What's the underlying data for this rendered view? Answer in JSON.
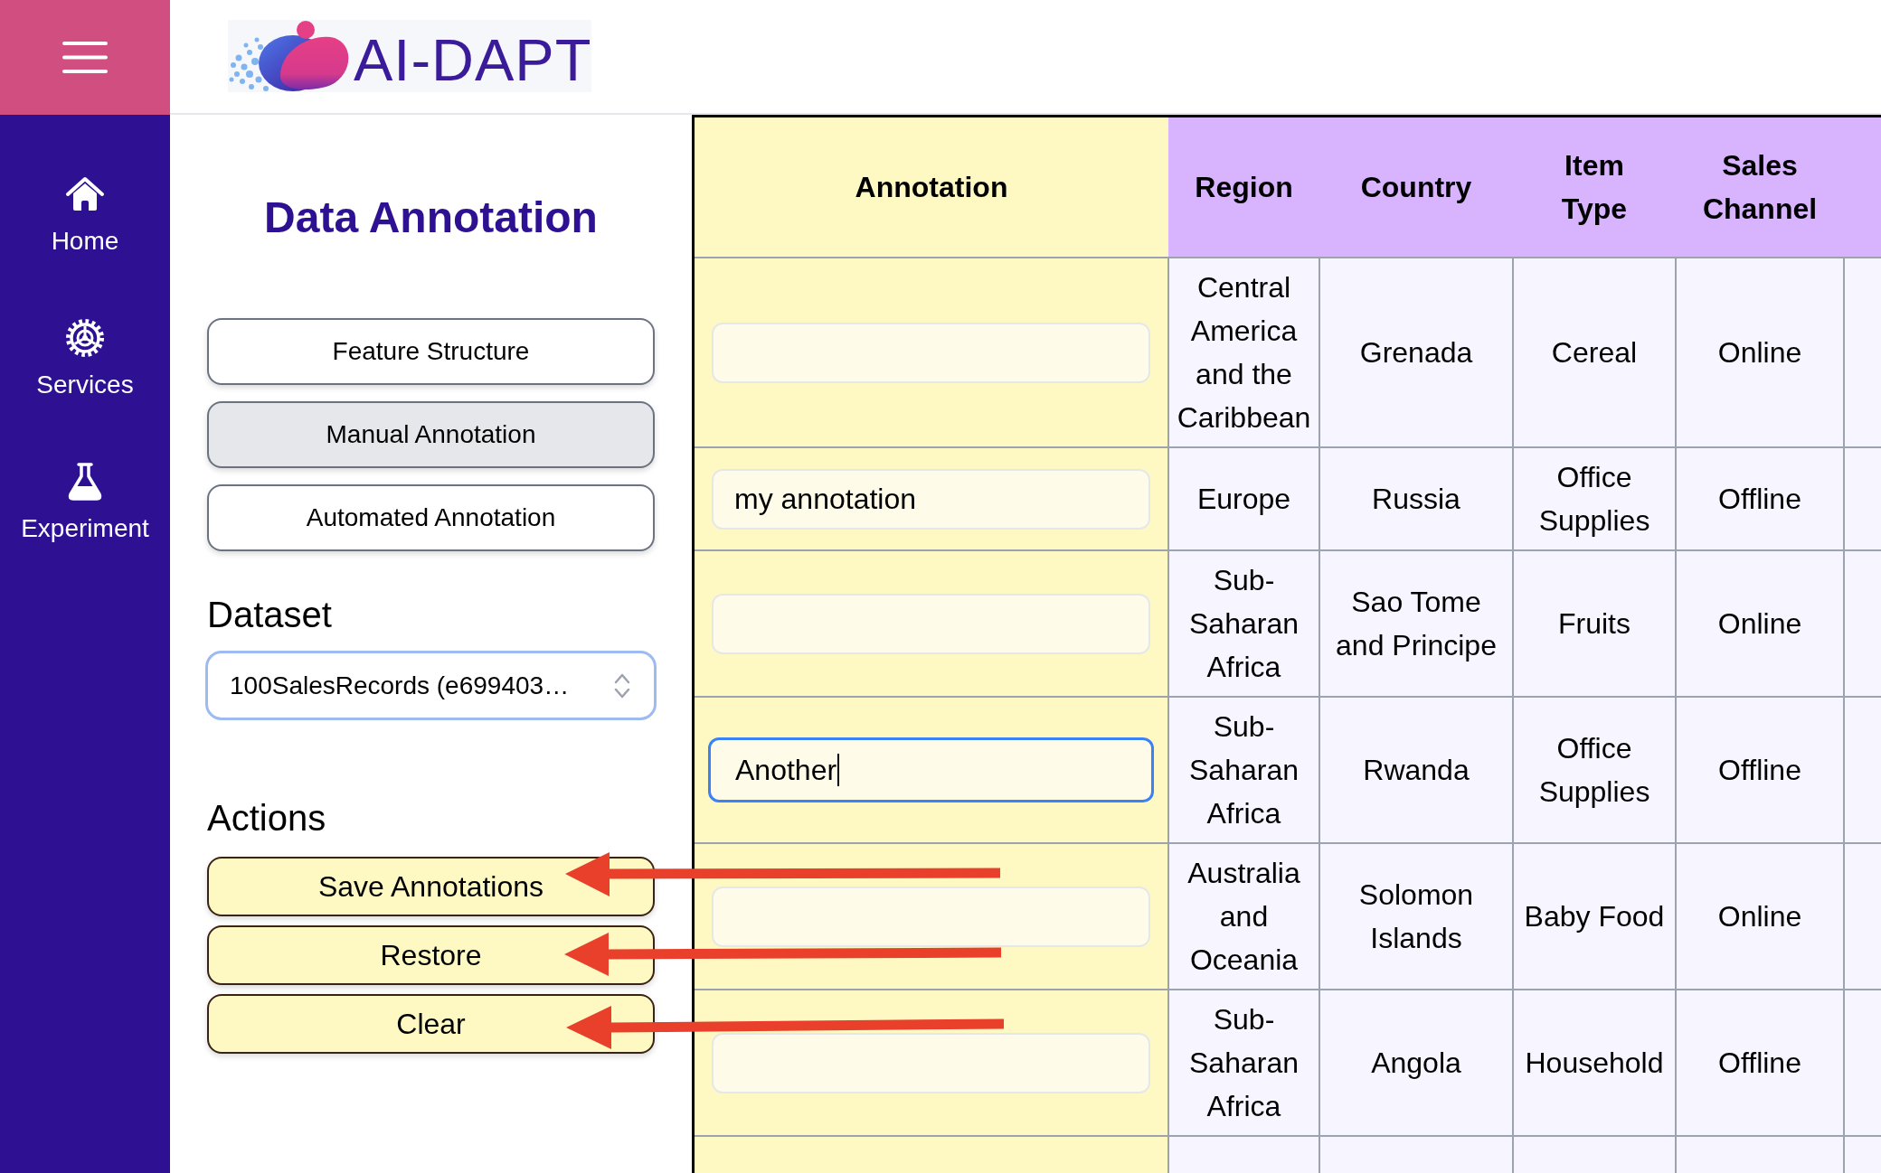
{
  "sidebar": {
    "items": [
      {
        "label": "Home",
        "selected": false
      },
      {
        "label": "Services",
        "selected": false
      },
      {
        "label": "Experiment",
        "selected": false
      }
    ]
  },
  "header": {
    "logo_text": "AI-DAPT"
  },
  "panel": {
    "title": "Data Annotation",
    "modes": [
      {
        "label": "Feature Structure",
        "selected": false
      },
      {
        "label": "Manual Annotation",
        "selected": true
      },
      {
        "label": "Automated Annotation",
        "selected": false
      }
    ],
    "dataset": {
      "label": "Dataset",
      "value": "100SalesRecords (e699403…"
    },
    "actions": {
      "label": "Actions",
      "buttons": [
        "Save Annotations",
        "Restore",
        "Clear"
      ]
    }
  },
  "table": {
    "columns": [
      {
        "label": "Annotation",
        "kind": "annotation"
      },
      {
        "label": "Region",
        "kind": "data"
      },
      {
        "label": "Country",
        "kind": "data"
      },
      {
        "label": "Item Type",
        "kind": "data"
      },
      {
        "label": "Sales Channel",
        "kind": "data"
      }
    ],
    "rows": [
      {
        "cells": [
          {
            "focused": false
          },
          "Central America and the Caribbean",
          "Grenada",
          "Cereal",
          "Online"
        ]
      },
      {
        "cells": [
          {
            "value": "my annotation",
            "focused": false
          },
          "Europe",
          "Russia",
          "Office Supplies",
          "Offline"
        ]
      },
      {
        "cells": [
          {
            "focused": false
          },
          "Sub-Saharan Africa",
          "Sao Tome and Principe",
          "Fruits",
          "Online"
        ]
      },
      {
        "cells": [
          {
            "value": "Another",
            "focused": true
          },
          "Sub-Saharan Africa",
          "Rwanda",
          "Office Supplies",
          "Offline"
        ]
      },
      {
        "cells": [
          {
            "focused": false
          },
          "Australia and Oceania",
          "Solomon Islands",
          "Baby Food",
          "Online"
        ]
      },
      {
        "cells": [
          {
            "focused": false
          },
          "Sub-Saharan Africa",
          "Angola",
          "Household",
          "Offline"
        ]
      }
    ]
  }
}
